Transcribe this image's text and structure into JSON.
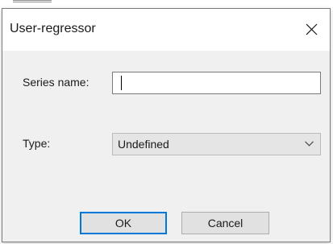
{
  "dialog": {
    "title": "User-regressor"
  },
  "series_name": {
    "label": "Series name:",
    "value": ""
  },
  "type": {
    "label": "Type:",
    "selected": "Undefined"
  },
  "buttons": {
    "ok": "OK",
    "cancel": "Cancel"
  },
  "icons": {
    "close": "close-icon",
    "dropdown": "chevron-down-icon"
  },
  "colors": {
    "dialog_bg": "#f0f0f0",
    "titlebar_bg": "#ffffff",
    "default_button_border": "#0078d7",
    "button_bg": "#e1e1e1",
    "select_bg": "#e5e5e5"
  }
}
